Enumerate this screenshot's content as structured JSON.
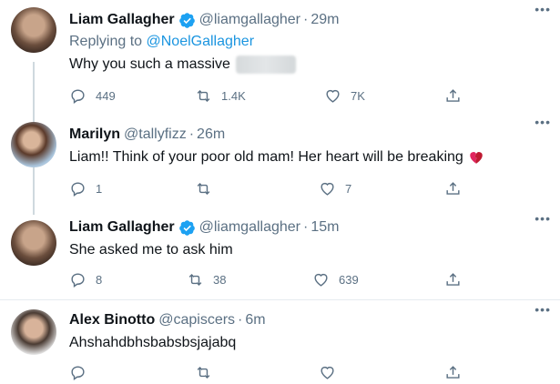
{
  "tweets": [
    {
      "name": "Liam Gallagher",
      "verified": true,
      "handle": "@liamgallagher",
      "time": "29m",
      "replying_to_prefix": "Replying to",
      "replying_to": "@NoelGallagher",
      "text": "Why you such a massive",
      "text_redacted": true,
      "replies": "449",
      "retweets": "1.4K",
      "likes": "7K"
    },
    {
      "name": "Marilyn",
      "verified": false,
      "handle": "@tallyfizz",
      "time": "26m",
      "text": "Liam!! Think of your poor old mam! Her heart will be breaking",
      "emoji": "broken-heart",
      "replies": "1",
      "retweets": "",
      "likes": "7"
    },
    {
      "name": "Liam Gallagher",
      "verified": true,
      "handle": "@liamgallagher",
      "time": "15m",
      "text": "She asked me to ask him",
      "replies": "8",
      "retweets": "38",
      "likes": "639"
    },
    {
      "name": "Alex Binotto",
      "verified": false,
      "handle": "@capiscers",
      "time": "6m",
      "text": "Ahshahdbhsbabsbsjajabq",
      "replies": "",
      "retweets": "",
      "likes": ""
    }
  ],
  "separator": "·",
  "more_label": "•••",
  "colors": {
    "accent": "#1b95e0",
    "secondary_text": "#5b7083",
    "verified": "#1da1f2",
    "broken_heart": "#e0245e"
  },
  "icons": [
    "verified-badge-icon",
    "more-icon",
    "reply-icon",
    "retweet-icon",
    "like-icon",
    "share-icon",
    "broken-heart-icon"
  ]
}
